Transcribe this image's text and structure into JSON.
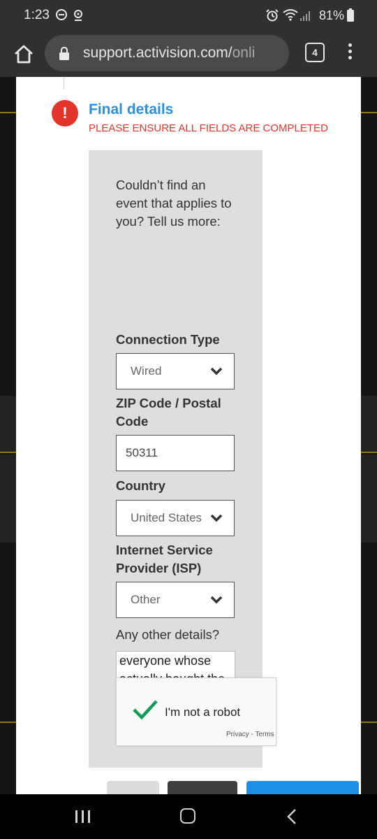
{
  "status_bar": {
    "time": "1:23",
    "battery": "81%",
    "icons": [
      "do-not-disturb-icon",
      "location-icon",
      "alarm-icon",
      "wifi-icon",
      "signal-icon",
      "battery-icon"
    ]
  },
  "browser": {
    "url_main": "support.activision.com/",
    "url_dim": "onli",
    "tab_count": "4"
  },
  "form": {
    "title": "Final details",
    "warning": "PLEASE ENSURE ALL FIELDS ARE COMPLETED",
    "intro": "Couldn’t find an event that applies to you? Tell us more:",
    "connection_type_label": "Connection Type",
    "connection_type_value": "Wired",
    "zip_label": "ZIP Code / Postal Code",
    "zip_value": "50311",
    "country_label": "Country",
    "country_value": "United States",
    "isp_label": "Internet Service Provider (ISP)",
    "isp_value": "Other",
    "details_label": "Any other details?",
    "details_value": "everyone whose actually bought the game from you. I won't make that mistake again."
  },
  "captcha": {
    "label": "I'm not a robot",
    "privacy": "Privacy - Terms"
  },
  "colors": {
    "accent_blue": "#2b90d9",
    "error_red": "#e2342b",
    "check_green": "#0f9d58"
  }
}
